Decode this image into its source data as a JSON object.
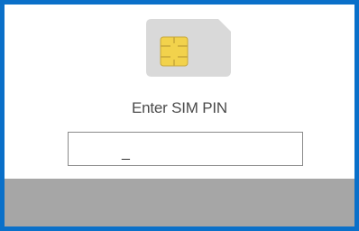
{
  "sim_prompt": {
    "title": "Enter SIM PIN",
    "icon": "sim-card-icon"
  },
  "pin_input": {
    "value": "_"
  },
  "colors": {
    "frame_border": "#0a70c9",
    "background": "#ffffff",
    "sim_card": "#d9d9d9",
    "sim_chip": "#f2d24c",
    "bottom_bar": "#a6a6a6",
    "text": "#4a4a4a"
  }
}
